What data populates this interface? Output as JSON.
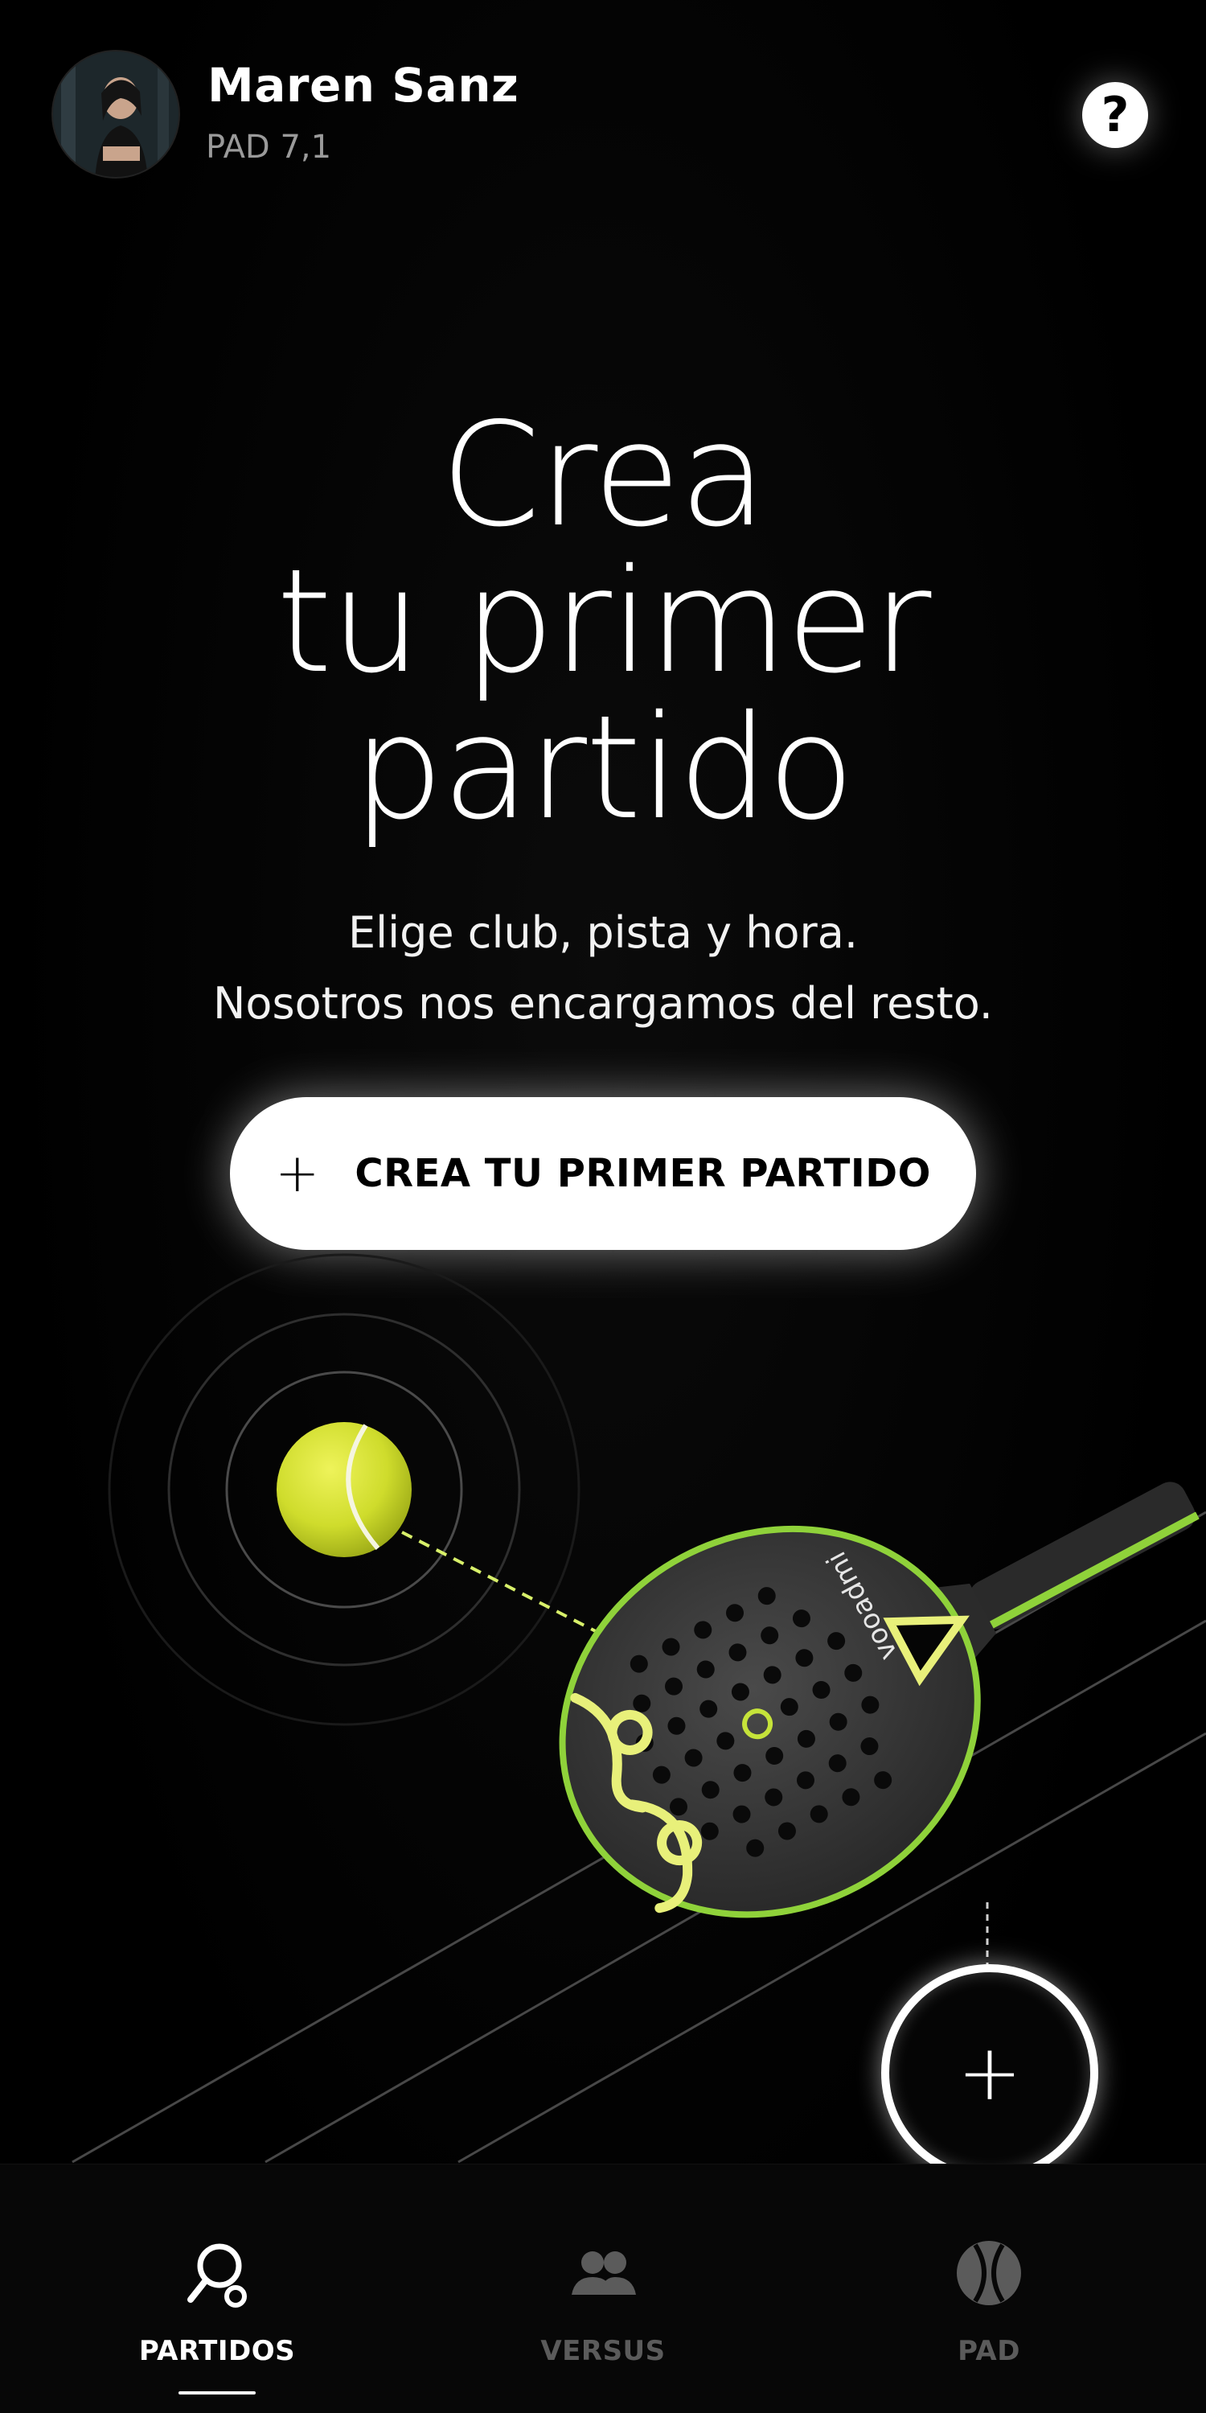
{
  "header": {
    "user_name": "Maren Sanz",
    "user_level": "PAD 7,1",
    "help_label": "?"
  },
  "hero": {
    "title_line1": "Crea",
    "title_line2": "tu primer",
    "title_line3": "partido",
    "subtitle_line1": "Elige club, pista y hora.",
    "subtitle_line2": "Nosotros nos encargamos del resto."
  },
  "cta": {
    "icon": "+",
    "label": "CREA TU PRIMER PARTIDO"
  },
  "illustration": {
    "racket_brand": "vooadmi"
  },
  "fab": {
    "icon": "+"
  },
  "tabs": [
    {
      "label": "PARTIDOS",
      "icon": "racket-ball-icon",
      "active": true
    },
    {
      "label": "VERSUS",
      "icon": "people-icon",
      "active": false
    },
    {
      "label": "PAD",
      "icon": "ball-icon",
      "active": false
    }
  ],
  "colors": {
    "background": "#000000",
    "accent": "#d8f06a",
    "ball": "#d6e23a",
    "inactive_tab": "#5b5b5b"
  }
}
